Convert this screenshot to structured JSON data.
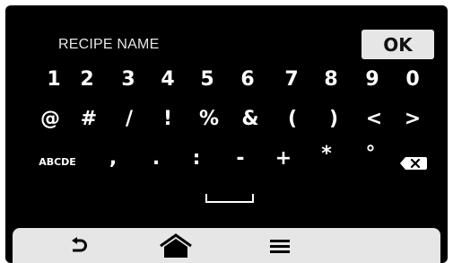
{
  "header": {
    "title": "RECIPE NAME",
    "ok_label": "OK"
  },
  "keyboard": {
    "row1": [
      "1",
      "2",
      "3",
      "4",
      "5",
      "6",
      "7",
      "8",
      "9",
      "0"
    ],
    "row2": [
      "@",
      "#",
      "/",
      "!",
      "%",
      "&",
      "(",
      ")",
      "<",
      ">"
    ],
    "row3": [
      "ABCDE",
      ",",
      ".",
      ":",
      "-",
      "+",
      "*",
      "°"
    ],
    "backspace_icon": "backspace-icon",
    "space_icon": "space-bar-icon"
  },
  "navbar": {
    "icons": [
      "back-arrow-icon",
      "home-icon",
      "menu-icon"
    ]
  },
  "colors": {
    "background": "#000000",
    "key_text": "#ffffff",
    "button_bg": "#e6e6e6"
  }
}
